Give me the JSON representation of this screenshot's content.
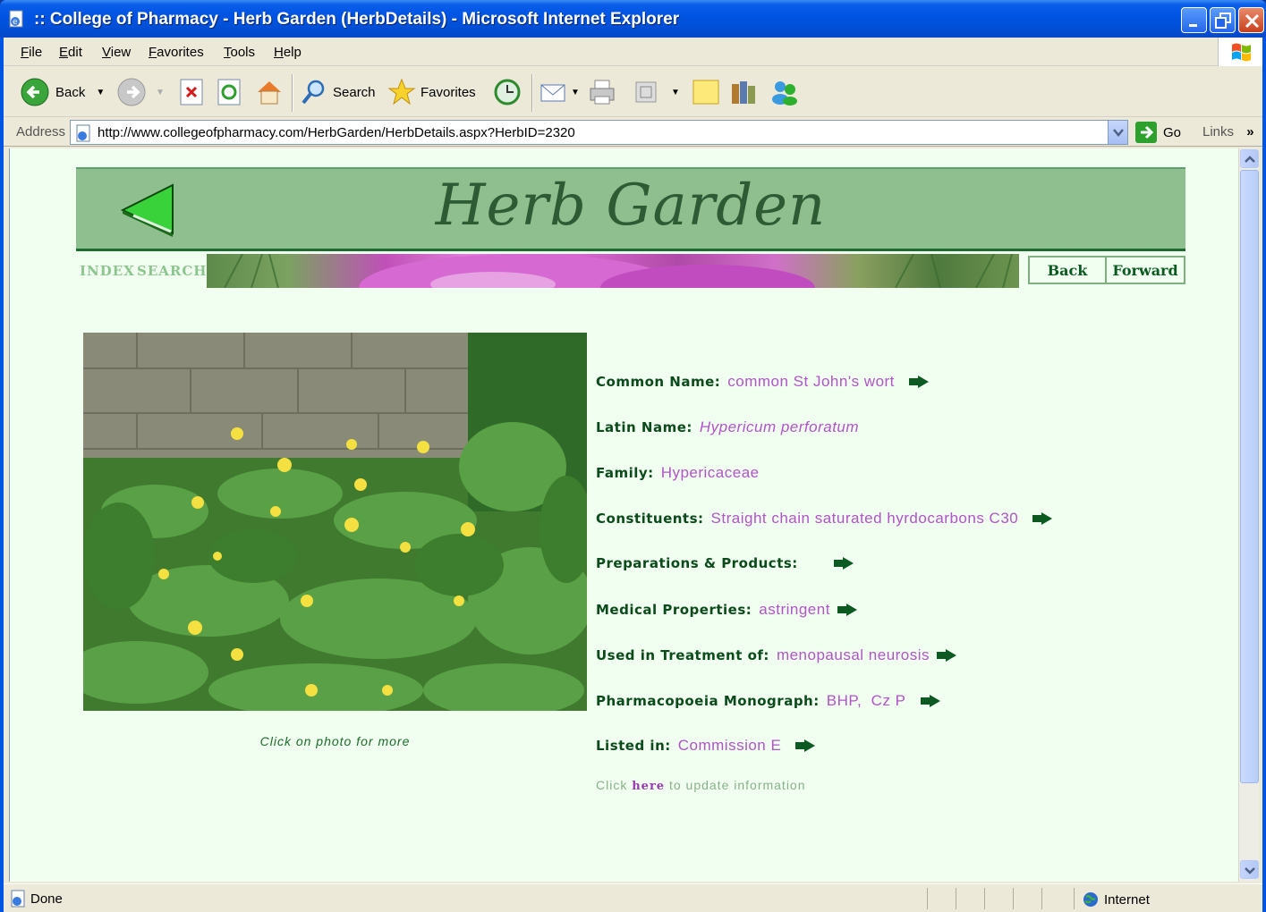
{
  "window": {
    "title": ":: College of Pharmacy - Herb Garden (HerbDetails) - Microsoft Internet Explorer"
  },
  "menu": [
    "File",
    "Edit",
    "View",
    "Favorites",
    "Tools",
    "Help"
  ],
  "toolbar": {
    "back_label": "Back",
    "search_label": "Search",
    "favorites_label": "Favorites"
  },
  "address": {
    "label": "Address",
    "url": "http://www.collegeofpharmacy.com/HerbGarden/HerbDetails.aspx?HerbID=2320",
    "go_label": "Go",
    "links_label": "Links"
  },
  "page": {
    "banner_title": "Herb Garden",
    "nav": {
      "index": "INDEX",
      "search": "SEARCH",
      "back": "Back",
      "forward": "Forward"
    },
    "photo_caption": "Click on photo for more",
    "fields": {
      "common_name": {
        "label": "Common Name:",
        "value": "common St John's wort"
      },
      "latin_name": {
        "label": "Latin Name:",
        "value": "Hypericum perforatum"
      },
      "family": {
        "label": "Family:",
        "value": "Hypericaceae"
      },
      "constituents": {
        "label": "Constituents:",
        "value": "Straight chain saturated hyrdocarbons C30"
      },
      "preparations": {
        "label": "Preparations & Products:",
        "value": ""
      },
      "medical": {
        "label": "Medical Properties:",
        "value": "astringent"
      },
      "treatment": {
        "label": "Used in Treatment of:",
        "value": "menopausal neurosis"
      },
      "monograph": {
        "label": "Pharmacopoeia Monograph:",
        "value": "BHP,  Cz P"
      },
      "listed": {
        "label": "Listed in:",
        "value": "Commission E"
      }
    },
    "update": {
      "prefix": "Click ",
      "link": "here",
      "suffix": " to update information"
    }
  },
  "status": {
    "text": "Done",
    "zone": "Internet"
  }
}
